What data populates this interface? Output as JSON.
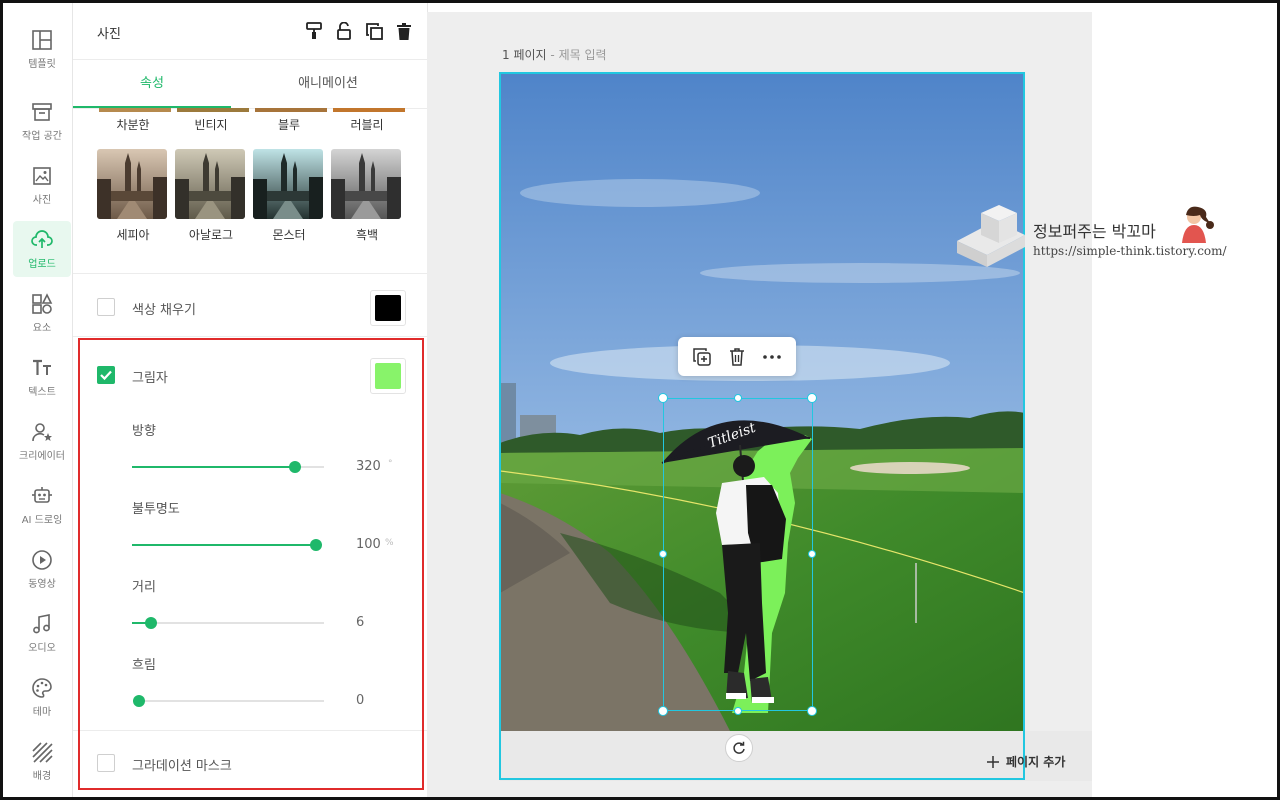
{
  "sidebar": {
    "items": [
      {
        "label": "템플릿",
        "icon": "template-icon"
      },
      {
        "label": "작업 공간",
        "icon": "workspace-icon"
      },
      {
        "label": "사진",
        "icon": "photo-icon"
      },
      {
        "label": "업로드",
        "icon": "upload-cloud-icon",
        "active": true
      },
      {
        "label": "요소",
        "icon": "shapes-icon"
      },
      {
        "label": "텍스트",
        "icon": "text-icon"
      },
      {
        "label": "크리에이터",
        "icon": "creator-icon"
      },
      {
        "label": "AI 드로잉",
        "icon": "ai-robot-icon"
      },
      {
        "label": "동영상",
        "icon": "video-play-icon"
      },
      {
        "label": "오디오",
        "icon": "music-note-icon"
      },
      {
        "label": "테마",
        "icon": "palette-icon"
      },
      {
        "label": "배경",
        "icon": "background-pattern-icon"
      }
    ]
  },
  "panel": {
    "title": "사진",
    "header_icons": [
      "paint-roller-icon",
      "unlock-icon",
      "duplicate-icon",
      "trash-icon"
    ],
    "tabs": [
      {
        "label": "속성",
        "active": true
      },
      {
        "label": "애니메이션",
        "active": false
      }
    ],
    "filters_row1": [
      "차분한",
      "빈티지",
      "블루",
      "러블리"
    ],
    "filters_row2": [
      "세피아",
      "아날로그",
      "몬스터",
      "흑백"
    ],
    "color_fill": {
      "label": "색상 채우기",
      "checked": false,
      "color": "#000000"
    },
    "shadow": {
      "label": "그림자",
      "checked": true,
      "color": "#88f36a",
      "sliders": [
        {
          "label": "방향",
          "value": "320",
          "unit": "°",
          "fraction": 0.85
        },
        {
          "label": "불투명도",
          "value": "100",
          "unit": "%",
          "fraction": 1.0
        },
        {
          "label": "거리",
          "value": "6",
          "unit": "",
          "fraction": 0.1
        },
        {
          "label": "흐림",
          "value": "0",
          "unit": "",
          "fraction": 0.0
        }
      ]
    },
    "gradient_mask": {
      "label": "그라데이션 마스크",
      "checked": false
    }
  },
  "canvas": {
    "page_number": "1 페이지",
    "separator": "-",
    "title_placeholder": "제목 입력",
    "toolbar_icons": [
      "duplicate-plus-icon",
      "trash-icon",
      "more-icon"
    ],
    "add_page_label": "페이지 추가"
  },
  "watermark": {
    "name": "정보퍼주는 박꼬마",
    "url": "https://simple-think.tistory.com/"
  },
  "colors": {
    "accent": "#1fb86a",
    "selection": "#22c7e0",
    "highlight": "#e02b2b"
  }
}
